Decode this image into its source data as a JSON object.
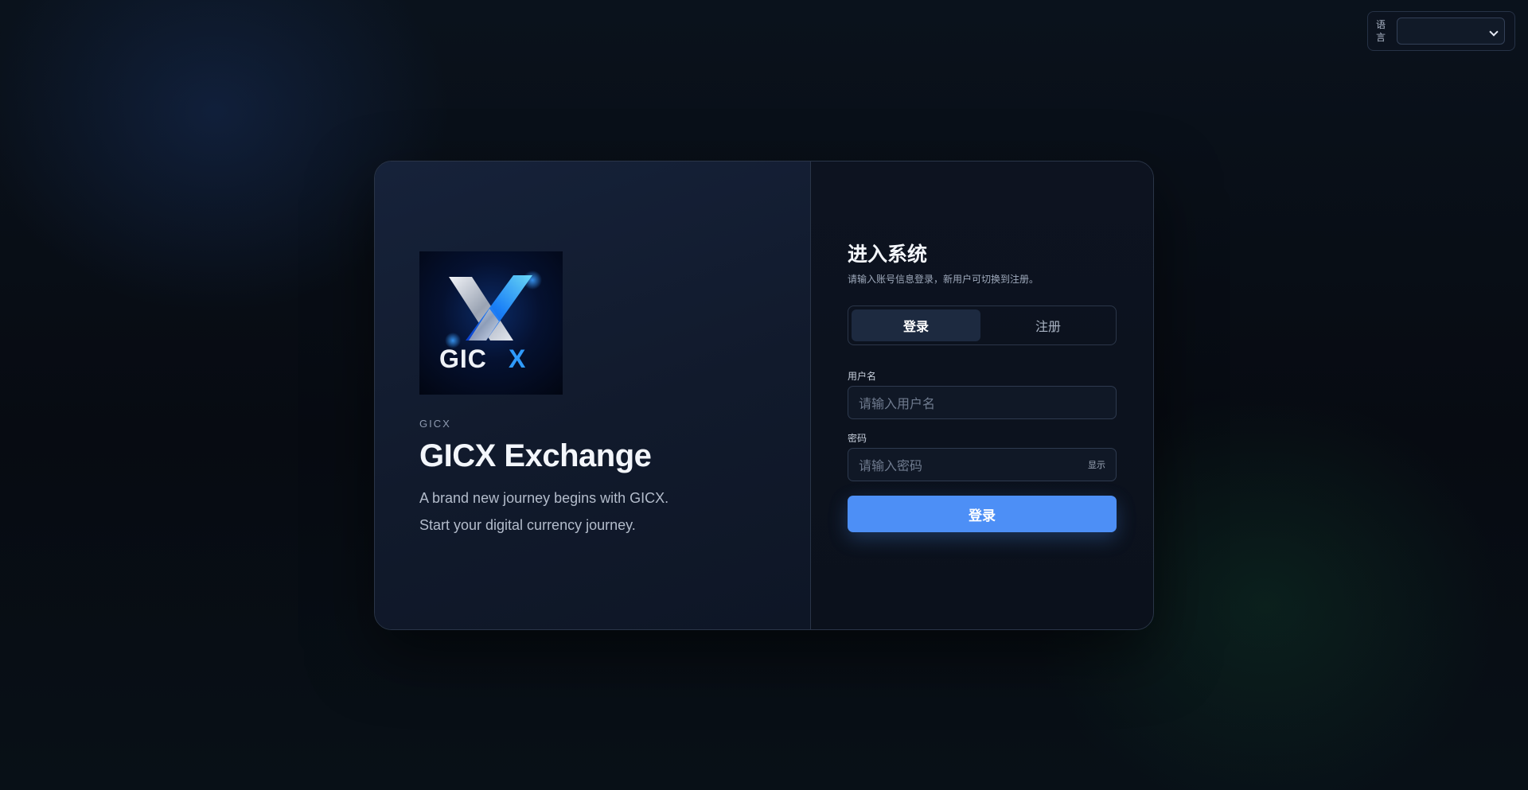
{
  "language": {
    "label": "语言",
    "selected": ""
  },
  "brand": {
    "logo_text": "GICX",
    "small_label": "GICX",
    "title": "GICX Exchange",
    "tagline_1": "A brand new journey begins with GICX.",
    "tagline_2": "Start your digital currency journey."
  },
  "form": {
    "title": "进入系统",
    "subtitle": "请输入账号信息登录，新用户可切换到注册。",
    "tabs": [
      {
        "label": "登录",
        "active": true
      },
      {
        "label": "注册",
        "active": false
      }
    ],
    "username_label": "用户名",
    "username_placeholder": "请输入用户名",
    "password_label": "密码",
    "password_placeholder": "请输入密码",
    "show_password_label": "显示",
    "submit_label": "登录"
  },
  "colors": {
    "accent": "#4d8ff6",
    "background": "#070b12",
    "card_left": "#16223a",
    "card_right": "#0d1320"
  }
}
